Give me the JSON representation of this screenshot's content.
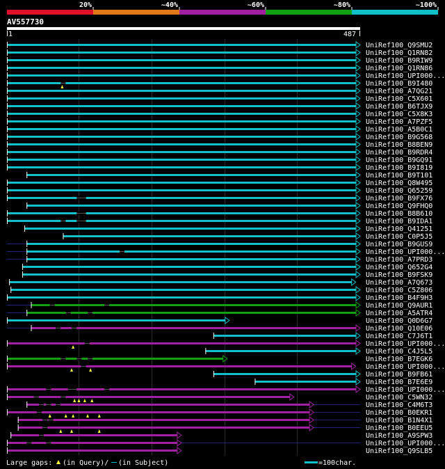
{
  "legend": {
    "ticks": [
      "20%",
      "~40%",
      "~60%",
      "~80%",
      "~100%"
    ],
    "colors": [
      "#e0102a",
      "#e07818",
      "#a020a0",
      "#10a010",
      "#10c0c8"
    ]
  },
  "colors": {
    "cyan": "#10c0c8",
    "green": "#10a010",
    "purple": "#a020a0",
    "gap": "#202070",
    "white": "#ffffff",
    "grid": "#2a2a2a"
  },
  "query": {
    "name": "AV557730",
    "start_label": "1",
    "end_label": "487",
    "length": 487
  },
  "footer": {
    "gap_label": "Large gaps:",
    "query_text": "(in Query)/",
    "subject_text": "(in Subject)",
    "scale_text": "=100char."
  },
  "chart_data": {
    "type": "alignment-overview",
    "query_length": 487,
    "grid_every": 100,
    "hits": [
      {
        "name": "UniRef100_Q9SMU2",
        "start": 1,
        "end": 487,
        "color": "cyan",
        "arrow": true
      },
      {
        "name": "UniRef100_Q1RN82",
        "start": 1,
        "end": 487,
        "color": "cyan",
        "arrow": true
      },
      {
        "name": "UniRef100_B9RIW9",
        "start": 1,
        "end": 487,
        "color": "cyan",
        "arrow": true
      },
      {
        "name": "UniRef100_Q1RN86",
        "start": 1,
        "end": 487,
        "color": "cyan",
        "arrow": true
      },
      {
        "name": "UniRef100_UPI000...",
        "start": 1,
        "end": 487,
        "color": "cyan",
        "arrow": true
      },
      {
        "name": "UniRef100_B9I480",
        "start": 1,
        "end": 487,
        "color": "cyan",
        "arrow": true,
        "gaps": [
          75
        ],
        "qmarks": [
          77
        ]
      },
      {
        "name": "UniRef100_A7QG21",
        "start": 1,
        "end": 487,
        "color": "cyan",
        "arrow": true
      },
      {
        "name": "UniRef100_C5X601",
        "start": 1,
        "end": 487,
        "color": "cyan",
        "arrow": true
      },
      {
        "name": "UniRef100_B6TJX9",
        "start": 1,
        "end": 487,
        "color": "cyan",
        "arrow": true
      },
      {
        "name": "UniRef100_C5X8K3",
        "start": 1,
        "end": 487,
        "color": "cyan",
        "arrow": true
      },
      {
        "name": "UniRef100_A7PZF5",
        "start": 1,
        "end": 487,
        "color": "cyan",
        "arrow": true
      },
      {
        "name": "UniRef100_A5B0C1",
        "start": 1,
        "end": 487,
        "color": "cyan",
        "arrow": true
      },
      {
        "name": "UniRef100_B9G568",
        "start": 1,
        "end": 487,
        "color": "cyan",
        "arrow": true
      },
      {
        "name": "UniRef100_B8BEN9",
        "start": 1,
        "end": 487,
        "color": "cyan",
        "arrow": true
      },
      {
        "name": "UniRef100_B9RDR4",
        "start": 1,
        "end": 487,
        "color": "cyan",
        "arrow": true
      },
      {
        "name": "UniRef100_B9GQ91",
        "start": 1,
        "end": 487,
        "color": "cyan",
        "arrow": true
      },
      {
        "name": "UniRef100_B9I819",
        "start": 1,
        "end": 487,
        "color": "cyan",
        "arrow": true
      },
      {
        "name": "UniRef100_B9T101",
        "start": 28,
        "end": 487,
        "color": "cyan",
        "arrow": true
      },
      {
        "name": "UniRef100_Q8W495",
        "start": 1,
        "end": 487,
        "color": "cyan",
        "arrow": true
      },
      {
        "name": "UniRef100_Q65259",
        "start": 1,
        "end": 487,
        "color": "cyan",
        "arrow": true
      },
      {
        "name": "UniRef100_B9FX76",
        "start": 1,
        "end": 487,
        "color": "cyan",
        "arrow": true,
        "gaps": [
          97,
          103
        ]
      },
      {
        "name": "UniRef100_Q9FHQ0",
        "start": 28,
        "end": 487,
        "color": "cyan",
        "arrow": true
      },
      {
        "name": "UniRef100_B8B610",
        "start": 1,
        "end": 487,
        "color": "cyan",
        "arrow": true,
        "gaps": [
          97,
          103
        ]
      },
      {
        "name": "UniRef100_B9IDA1",
        "start": 1,
        "end": 487,
        "color": "cyan",
        "arrow": true,
        "gaps": [
          75,
          97,
          103
        ]
      },
      {
        "name": "UniRef100_Q41251",
        "start": 25,
        "end": 487,
        "color": "cyan",
        "arrow": true
      },
      {
        "name": "UniRef100_C0P5J5",
        "start": 78,
        "end": 487,
        "color": "cyan",
        "arrow": true
      },
      {
        "name": "UniRef100_B9GUS9",
        "start": 28,
        "end": 487,
        "color": "cyan",
        "arrow": true,
        "pre": 1
      },
      {
        "name": "UniRef100_UPI000...",
        "start": 28,
        "end": 487,
        "color": "cyan",
        "arrow": true,
        "pre": 1,
        "gaps": [
          156
        ]
      },
      {
        "name": "UniRef100_A7PRD3",
        "start": 28,
        "end": 487,
        "color": "cyan",
        "arrow": true,
        "pre": 1
      },
      {
        "name": "UniRef100_Q652G4",
        "start": 22,
        "end": 487,
        "color": "cyan",
        "arrow": true
      },
      {
        "name": "UniRef100_B9FSK9",
        "start": 22,
        "end": 487,
        "color": "cyan",
        "arrow": true
      },
      {
        "name": "UniRef100_A7Q673",
        "start": 4,
        "end": 481,
        "color": "cyan",
        "arrow": true
      },
      {
        "name": "UniRef100_C5Z806",
        "start": 6,
        "end": 487,
        "color": "cyan",
        "arrow": true
      },
      {
        "name": "UniRef100_B4F9H3",
        "start": 1,
        "end": 487,
        "color": "cyan",
        "arrow": true
      },
      {
        "name": "UniRef100_Q9AUR1",
        "start": 34,
        "end": 487,
        "color": "green",
        "arrow": true,
        "pre": 1,
        "gaps": [
          60,
          135
        ]
      },
      {
        "name": "UniRef100_A5ATR4",
        "start": 28,
        "end": 487,
        "color": "green",
        "arrow": true,
        "pre": 1,
        "gaps": [
          82,
          112
        ]
      },
      {
        "name": "UniRef100_Q0D6G7",
        "start": 1,
        "end": 307,
        "color": "cyan",
        "arrow": true
      },
      {
        "name": "UniRef100_Q10E06",
        "start": 34,
        "end": 487,
        "color": "purple",
        "arrow": true,
        "pre": 1,
        "gaps": [
          68,
          90
        ]
      },
      {
        "name": "UniRef100_C7J6T1",
        "start": 285,
        "end": 487,
        "color": "cyan",
        "arrow": true
      },
      {
        "name": "UniRef100_UPI000...",
        "start": 1,
        "end": 487,
        "color": "purple",
        "arrow": true,
        "gaps": [
          108
        ],
        "qmarks": [
          92
        ]
      },
      {
        "name": "UniRef100_C4J5L5",
        "start": 274,
        "end": 487,
        "color": "cyan",
        "arrow": true
      },
      {
        "name": "UniRef100_B7EGK6",
        "start": 1,
        "end": 304,
        "color": "green",
        "arrow": true,
        "gaps": [
          75,
          97,
          112
        ]
      },
      {
        "name": "UniRef100_UPI000...",
        "start": 1,
        "end": 481,
        "color": "purple",
        "arrow": true,
        "gaps": [
          103
        ],
        "qmarks": [
          90,
          116
        ]
      },
      {
        "name": "UniRef100_B9FB61",
        "start": 285,
        "end": 487,
        "color": "cyan",
        "arrow": true
      },
      {
        "name": "UniRef100_B7E6E9",
        "start": 342,
        "end": 487,
        "color": "cyan",
        "arrow": true
      },
      {
        "name": "UniRef100_UPI000...",
        "start": 1,
        "end": 487,
        "color": "purple",
        "arrow": true,
        "pre": 0,
        "gaps": [
          55,
          85,
          90,
          135
        ]
      },
      {
        "name": "UniRef100_C5WN32",
        "start": 1,
        "end": 396,
        "color": "purple",
        "arrow": true,
        "gaps": [
          38,
          75
        ],
        "qmarks": [
          94,
          100,
          108,
          118
        ]
      },
      {
        "name": "UniRef100_C4M6T3",
        "start": 28,
        "end": 423,
        "color": "purple",
        "arrow": true,
        "post": 487,
        "gaps": [
          45,
          55,
          68
        ]
      },
      {
        "name": "UniRef100_B0EKR1",
        "start": 1,
        "end": 423,
        "color": "purple",
        "arrow": true,
        "post": 487,
        "gaps": [
          42
        ],
        "qmarks": [
          60,
          82,
          92,
          112,
          128
        ]
      },
      {
        "name": "UniRef100_B1N4X1",
        "start": 16,
        "end": 423,
        "color": "purple",
        "arrow": true,
        "post": 487,
        "gaps": [
          50,
          58
        ]
      },
      {
        "name": "UniRef100_B0EEU5",
        "start": 16,
        "end": 423,
        "color": "purple",
        "arrow": true,
        "post": 487,
        "gaps": [
          50
        ],
        "qmarks": [
          75,
          90,
          128
        ]
      },
      {
        "name": "UniRef100_A9SPW3",
        "start": 6,
        "end": 241,
        "color": "purple",
        "arrow": true,
        "gaps": [
          45
        ]
      },
      {
        "name": "UniRef100_UPI000...",
        "start": 1,
        "end": 241,
        "color": "purple",
        "arrow": true,
        "post": 487,
        "gaps": [
          28,
          55
        ]
      },
      {
        "name": "UniRef100_Q9SLB5",
        "start": 1,
        "end": 241,
        "color": "purple",
        "arrow": true
      }
    ]
  }
}
